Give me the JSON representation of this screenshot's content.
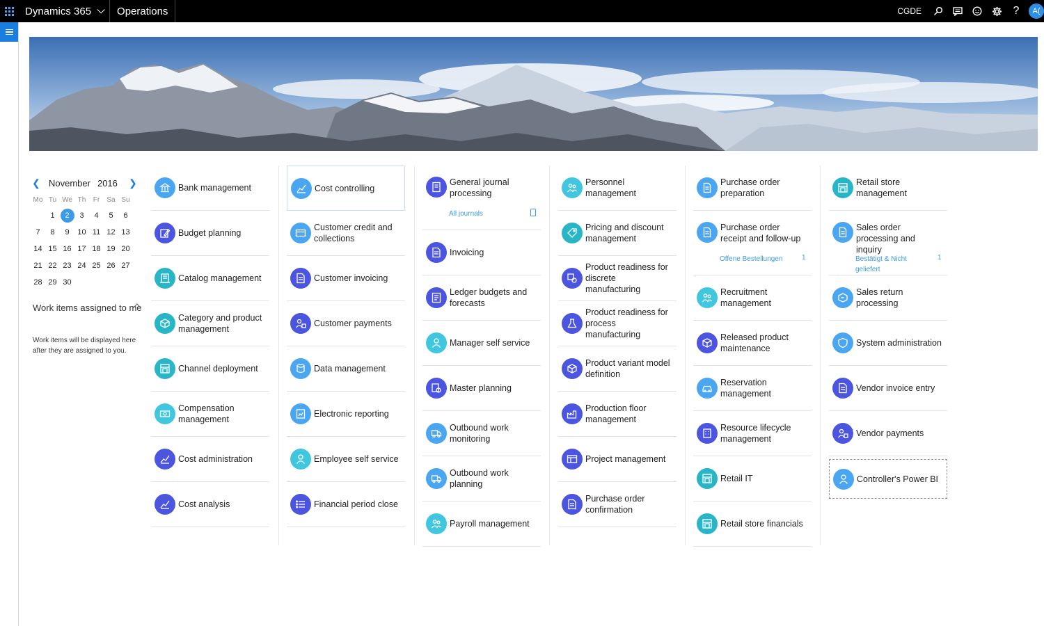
{
  "topbar": {
    "brand": "Dynamics 365",
    "module": "Operations",
    "company": "CGDE",
    "avatar_initials": "A("
  },
  "calendar": {
    "month": "November",
    "year": "2016",
    "weekdays": [
      "Mo",
      "Tu",
      "We",
      "Th",
      "Fr",
      "Sa",
      "Su"
    ],
    "selected_day": "2",
    "rows": [
      [
        "",
        "1",
        "2",
        "3",
        "4",
        "5",
        "6"
      ],
      [
        "7",
        "8",
        "9",
        "10",
        "11",
        "12",
        "13"
      ],
      [
        "14",
        "15",
        "16",
        "17",
        "18",
        "19",
        "20"
      ],
      [
        "21",
        "22",
        "23",
        "24",
        "25",
        "26",
        "27"
      ],
      [
        "28",
        "29",
        "30",
        "",
        "",
        "",
        ""
      ]
    ]
  },
  "work_items": {
    "title": "Work items assigned to me",
    "description": "Work items will be displayed here after they are assigned to you."
  },
  "columns": [
    [
      {
        "label": "Bank management",
        "icon": "bank-icon",
        "color": "c-light"
      },
      {
        "label": "Budget planning",
        "icon": "pen-icon",
        "color": "c-indigo"
      },
      {
        "label": "Catalog management",
        "icon": "catalog-icon",
        "color": "c-teal"
      },
      {
        "label": "Category and product management",
        "icon": "box-icon",
        "color": "c-teal"
      },
      {
        "label": "Channel deployment",
        "icon": "store-icon",
        "color": "c-teal"
      },
      {
        "label": "Compensation management",
        "icon": "money-icon",
        "color": "c-cyan"
      },
      {
        "label": "Cost administration",
        "icon": "chart-icon",
        "color": "c-indigo"
      },
      {
        "label": "Cost analysis",
        "icon": "chart-icon",
        "color": "c-indigo"
      }
    ],
    [
      {
        "label": "Cost controlling",
        "icon": "chart-icon",
        "color": "c-light",
        "focus": true
      },
      {
        "label": "Customer credit and collections",
        "icon": "card-icon",
        "color": "c-light"
      },
      {
        "label": "Customer invoicing",
        "icon": "invoice-icon",
        "color": "c-indigo"
      },
      {
        "label": "Customer payments",
        "icon": "person-money-icon",
        "color": "c-indigo"
      },
      {
        "label": "Data management",
        "icon": "data-icon",
        "color": "c-light"
      },
      {
        "label": "Electronic reporting",
        "icon": "report-icon",
        "color": "c-light"
      },
      {
        "label": "Employee self service",
        "icon": "person-icon",
        "color": "c-cyan"
      },
      {
        "label": "Financial period close",
        "icon": "list-icon",
        "color": "c-indigo"
      }
    ],
    [
      {
        "label": "General journal processing",
        "icon": "journal-icon",
        "color": "c-indigo",
        "sub": "All journals",
        "pin": true
      },
      {
        "label": "Invoicing",
        "icon": "invoice-icon",
        "color": "c-indigo"
      },
      {
        "label": "Ledger budgets and forecasts",
        "icon": "ledger-icon",
        "color": "c-indigo"
      },
      {
        "label": "Manager self service",
        "icon": "person-icon",
        "color": "c-cyan"
      },
      {
        "label": "Master planning",
        "icon": "plan-icon",
        "color": "c-indigo"
      },
      {
        "label": "Outbound work monitoring",
        "icon": "truck-icon",
        "color": "c-light"
      },
      {
        "label": "Outbound work planning",
        "icon": "truck-icon",
        "color": "c-light"
      },
      {
        "label": "Payroll management",
        "icon": "people-icon",
        "color": "c-cyan"
      }
    ],
    [
      {
        "label": "Personnel management",
        "icon": "people-icon",
        "color": "c-cyan"
      },
      {
        "label": "Pricing and discount management",
        "icon": "tag-icon",
        "color": "c-teal"
      },
      {
        "label": "Product readiness for discrete manufacturing",
        "icon": "gear-box-icon",
        "color": "c-indigo"
      },
      {
        "label": "Product readiness for process manufacturing",
        "icon": "flask-icon",
        "color": "c-indigo"
      },
      {
        "label": "Product variant model definition",
        "icon": "cube-icon",
        "color": "c-indigo"
      },
      {
        "label": "Production floor management",
        "icon": "factory-icon",
        "color": "c-indigo"
      },
      {
        "label": "Project management",
        "icon": "project-icon",
        "color": "c-indigo"
      },
      {
        "label": "Purchase order confirmation",
        "icon": "invoice-icon",
        "color": "c-indigo"
      }
    ],
    [
      {
        "label": "Purchase order preparation",
        "icon": "document-icon",
        "color": "c-light"
      },
      {
        "label": "Purchase order receipt and follow-up",
        "icon": "document-icon",
        "color": "c-light",
        "sub": "Offene Bestellungen",
        "count": "1"
      },
      {
        "label": "Recruitment management",
        "icon": "people-icon",
        "color": "c-cyan"
      },
      {
        "label": "Released product maintenance",
        "icon": "cube-icon",
        "color": "c-indigo"
      },
      {
        "label": "Reservation management",
        "icon": "car-icon",
        "color": "c-light"
      },
      {
        "label": "Resource lifecycle management",
        "icon": "building-icon",
        "color": "c-indigo"
      },
      {
        "label": "Retail IT",
        "icon": "store-icon",
        "color": "c-teal"
      },
      {
        "label": "Retail store financials",
        "icon": "store-icon",
        "color": "c-teal"
      }
    ],
    [
      {
        "label": "Retail store management",
        "icon": "store-icon",
        "color": "c-teal"
      },
      {
        "label": "Sales order processing and inquiry",
        "icon": "document-icon",
        "color": "c-light",
        "sub": "Bestätigt & Nicht geliefert",
        "count": "1"
      },
      {
        "label": "Sales return processing",
        "icon": "return-icon",
        "color": "c-light"
      },
      {
        "label": "System administration",
        "icon": "shield-icon",
        "color": "c-light"
      },
      {
        "label": "Vendor invoice entry",
        "icon": "invoice-icon",
        "color": "c-indigo"
      },
      {
        "label": "Vendor payments",
        "icon": "person-money-icon",
        "color": "c-indigo"
      },
      {
        "label": "Controller's Power BI",
        "icon": "person-icon",
        "color": "c-light",
        "boxed": true
      }
    ]
  ]
}
